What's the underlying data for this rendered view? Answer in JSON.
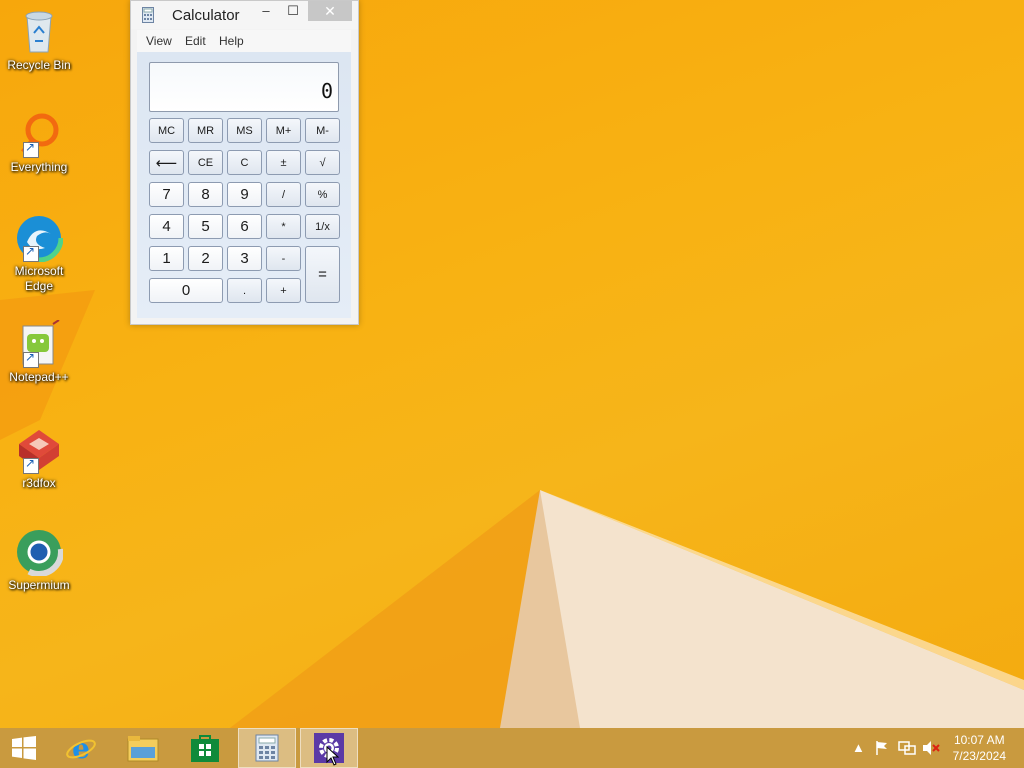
{
  "desktop": {
    "icons": [
      {
        "label": "Recycle Bin"
      },
      {
        "label": "Everything"
      },
      {
        "label": "Microsoft Edge"
      },
      {
        "label": "Notepad++"
      },
      {
        "label": "r3dfox"
      },
      {
        "label": "Supermium"
      }
    ]
  },
  "calculator": {
    "title": "Calculator",
    "controls": {
      "minimize": "‒",
      "maximize": "☐",
      "close": "✕"
    },
    "menu": [
      "View",
      "Edit",
      "Help"
    ],
    "display": "0",
    "keys": {
      "mc": "MC",
      "mr": "MR",
      "ms": "MS",
      "mplus": "M+",
      "mminus": "M-",
      "back": "⟵",
      "ce": "CE",
      "c": "C",
      "plusminus": "±",
      "sqrt": "√",
      "n7": "7",
      "n8": "8",
      "n9": "9",
      "div": "/",
      "percent": "%",
      "n4": "4",
      "n5": "5",
      "n6": "6",
      "mul": "*",
      "recip": "1/x",
      "n1": "1",
      "n2": "2",
      "n3": "3",
      "minus": "-",
      "equals": "=",
      "n0": "0",
      "dot": ".",
      "plus": "+"
    }
  },
  "taskbar": {
    "clock_time": "10:07 AM",
    "clock_date": "7/23/2024"
  },
  "colors": {
    "wallpaper": "#f7ab10",
    "taskbar": "#c99a3f"
  }
}
